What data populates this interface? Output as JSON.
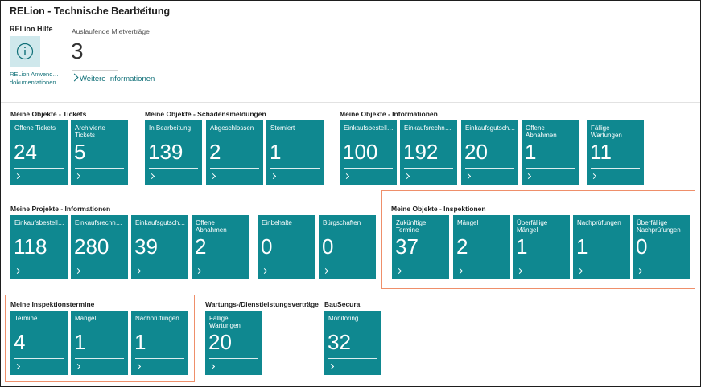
{
  "app": {
    "title": "RELion - Technische Bearbeitung"
  },
  "hilfe": {
    "heading": "RELion Hilfe",
    "link_line1": "RELion Anwend…",
    "link_line2": "dokumentationen",
    "icon": "info-icon"
  },
  "mietvertraege": {
    "heading": "Auslaufende Mietverträge",
    "value": "3",
    "more_label": "Weitere Informationen"
  },
  "colors": {
    "tile": "#0f8890",
    "link": "#0f6f77",
    "highlight": "#ef8f6a"
  },
  "groups": {
    "tickets": {
      "heading": "Meine Objekte - Tickets",
      "tiles": [
        {
          "label": "Offene Tickets",
          "value": "24"
        },
        {
          "label": "Archivierte Tickets",
          "value": "5"
        }
      ]
    },
    "schaden": {
      "heading": "Meine Objekte - Schadensmeldungen",
      "tiles": [
        {
          "label": "In Bearbeitung",
          "value": "139"
        },
        {
          "label": "Abgeschlossen",
          "value": "2"
        },
        {
          "label": "Storniert",
          "value": "1"
        }
      ]
    },
    "obj_info": {
      "heading": "Meine Objekte - Informationen",
      "tiles": [
        {
          "label": "Einkaufsbestell…",
          "value": "100"
        },
        {
          "label": "Einkaufsrechn…",
          "value": "192"
        },
        {
          "label": "Einkaufsgutsch…",
          "value": "20"
        },
        {
          "label": "Offene Abnahmen",
          "value": "1"
        },
        {
          "label": "Fällige Wartungen",
          "value": "11"
        }
      ]
    },
    "proj_info": {
      "heading": "Meine Projekte - Informationen",
      "tiles": [
        {
          "label": "Einkaufsbestell…",
          "value": "118"
        },
        {
          "label": "Einkaufsrechn…",
          "value": "280"
        },
        {
          "label": "Einkaufsgutsch…",
          "value": "39"
        },
        {
          "label": "Offene Abnahmen",
          "value": "2"
        },
        {
          "label": "Einbehalte",
          "value": "0"
        },
        {
          "label": "Bürgschaften",
          "value": "0"
        }
      ]
    },
    "inspektionen": {
      "heading": "Meine Objekte - Inspektionen",
      "tiles": [
        {
          "label": "Zukünftige Termine",
          "value": "37"
        },
        {
          "label": "Mängel",
          "value": "2"
        },
        {
          "label": "Überfällige Mängel",
          "value": "1"
        },
        {
          "label": "Nachprüfungen",
          "value": "1"
        },
        {
          "label": "Überfällige Nachprüfungen",
          "value": "0"
        }
      ]
    },
    "inspektionstermine": {
      "heading": "Meine Inspektionstermine",
      "tiles": [
        {
          "label": "Termine",
          "value": "4"
        },
        {
          "label": "Mängel",
          "value": "1"
        },
        {
          "label": "Nachprüfungen",
          "value": "1"
        }
      ]
    },
    "wartung": {
      "heading": "Wartungs-/Dienstleistungsverträge",
      "tiles": [
        {
          "label": "Fällige Wartungen",
          "value": "20"
        }
      ]
    },
    "bausecura": {
      "heading": "BauSecura",
      "tiles": [
        {
          "label": "Monitoring",
          "value": "32"
        }
      ]
    }
  }
}
